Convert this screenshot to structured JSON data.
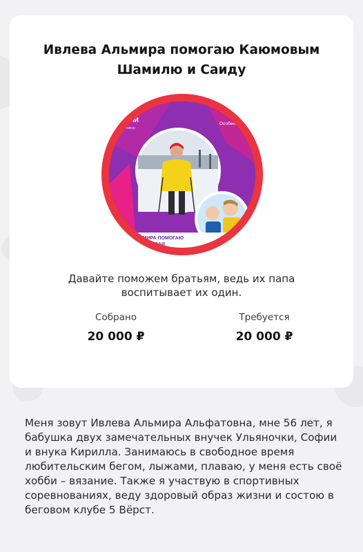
{
  "campaign": {
    "title": "Ивлева Альмира помогаю Каюмовым Шамилю и Саиду",
    "description": "Давайте поможем братьям, ведь их папа воспитывает их один.",
    "collected": {
      "label": "Собрано",
      "value": "20 000 ₽"
    },
    "required": {
      "label": "Требуется",
      "value": "20 000 ₽"
    },
    "image": {
      "banner_left": "ИМСКИЙ",
      "banner_left_sub": "ЛЫЙ МАРАФОН",
      "banner_right": "Особенн",
      "caption_line1": "ВА АЛЬМИРА ПОМОГАЮ",
      "caption_line2": "ШАМИЛЮ И САИ"
    }
  },
  "bio": {
    "text": "Меня зовут Ивлева Альмира Альфатовна, мне 56 лет, я бабушка двух замечательных внучек Ульяночки, Софии и внука Кирилла. Занимаюсь в свободное время любительским бегом, лыжами, плаваю, у меня есть своё хобби – вязание. Также я участвую в спортивных соревнованиях, веду здоровый образ жизни и состою в беговом клубе 5 Вёрст."
  },
  "colors": {
    "ring": "#ea3440",
    "background": "#f2f2f4",
    "card": "#ffffff",
    "banner_purple": "#8d2fb0",
    "banner_pink": "#e8208a"
  }
}
